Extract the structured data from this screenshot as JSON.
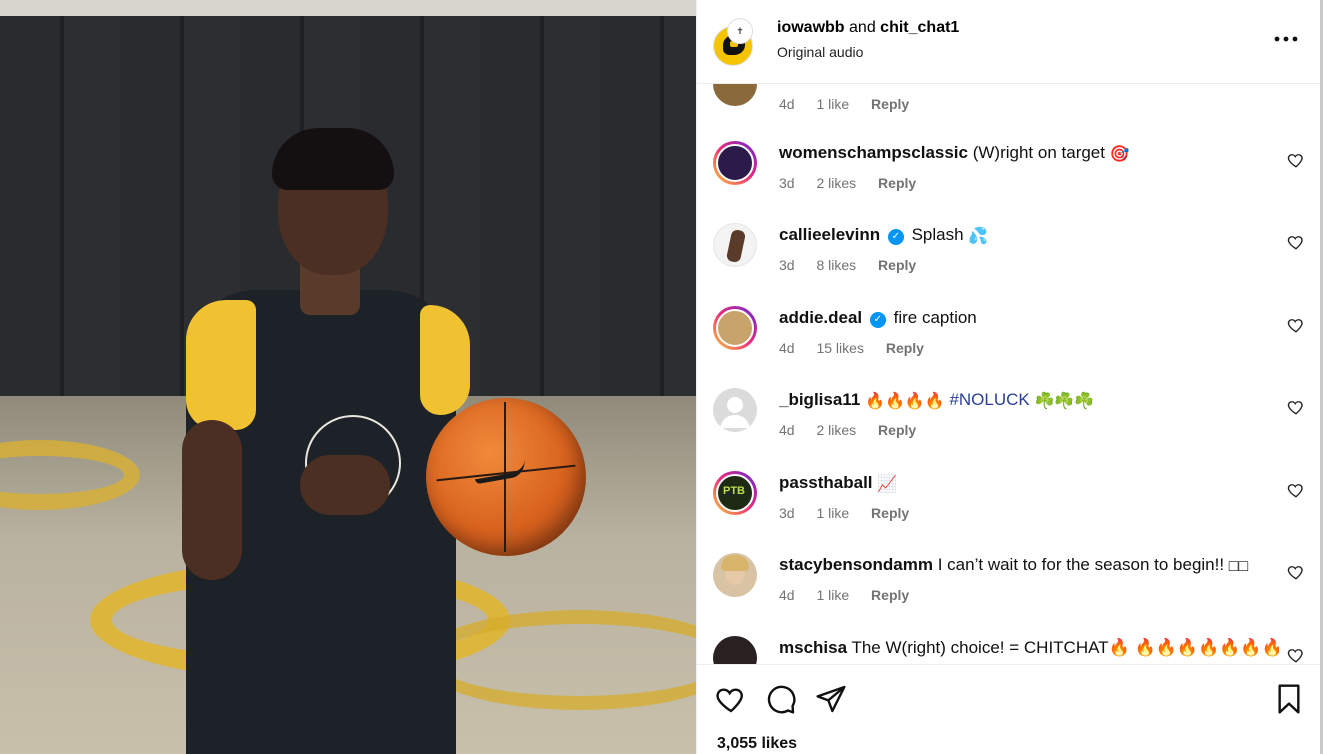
{
  "media": {
    "alt": ""
  },
  "header": {
    "user1": "iowawbb",
    "connector": "and",
    "user2": "chit_chat1",
    "audio": "Original audio",
    "more_label": "•••"
  },
  "comments": [
    {
      "meta_time": "4d",
      "meta_likes": "1 like",
      "reply": "Reply",
      "partial": true
    },
    {
      "user": "womenschampsclassic",
      "text": "(W)right on target",
      "emoji": "🎯",
      "verified": false,
      "time": "3d",
      "likes": "2 likes",
      "reply": "Reply"
    },
    {
      "user": "callieelevinn",
      "text": "Splash",
      "emoji": "💦",
      "verified": true,
      "time": "3d",
      "likes": "8 likes",
      "reply": "Reply"
    },
    {
      "user": "addie.deal",
      "text": "fire caption",
      "emoji": "",
      "verified": true,
      "time": "4d",
      "likes": "15 likes",
      "reply": "Reply"
    },
    {
      "user": "_biglisa11",
      "text": "🔥🔥🔥🔥",
      "hashtag": "#NOLUCK",
      "emoji": "☘️☘️☘️",
      "verified": false,
      "time": "4d",
      "likes": "2 likes",
      "reply": "Reply"
    },
    {
      "user": "passthaball",
      "text": "",
      "emoji": "📈",
      "verified": false,
      "time": "3d",
      "likes": "1 like",
      "reply": "Reply"
    },
    {
      "user": "stacybensondamm",
      "text": "I can’t wait to for the season to begin!! ",
      "emoji": "□□",
      "verified": false,
      "time": "4d",
      "likes": "1 like",
      "reply": "Reply"
    },
    {
      "user": "mschisa",
      "text": "The W(right) choice! = CHITCHAT🔥 🔥🔥🔥🔥🔥🔥🔥",
      "emoji": "",
      "verified": false,
      "partial": true
    }
  ],
  "footer": {
    "likes": "3,055 likes"
  },
  "icons": {
    "like": "heart-icon",
    "comment": "comment-icon",
    "share": "share-icon",
    "save": "bookmark-icon",
    "more": "more-icon"
  }
}
